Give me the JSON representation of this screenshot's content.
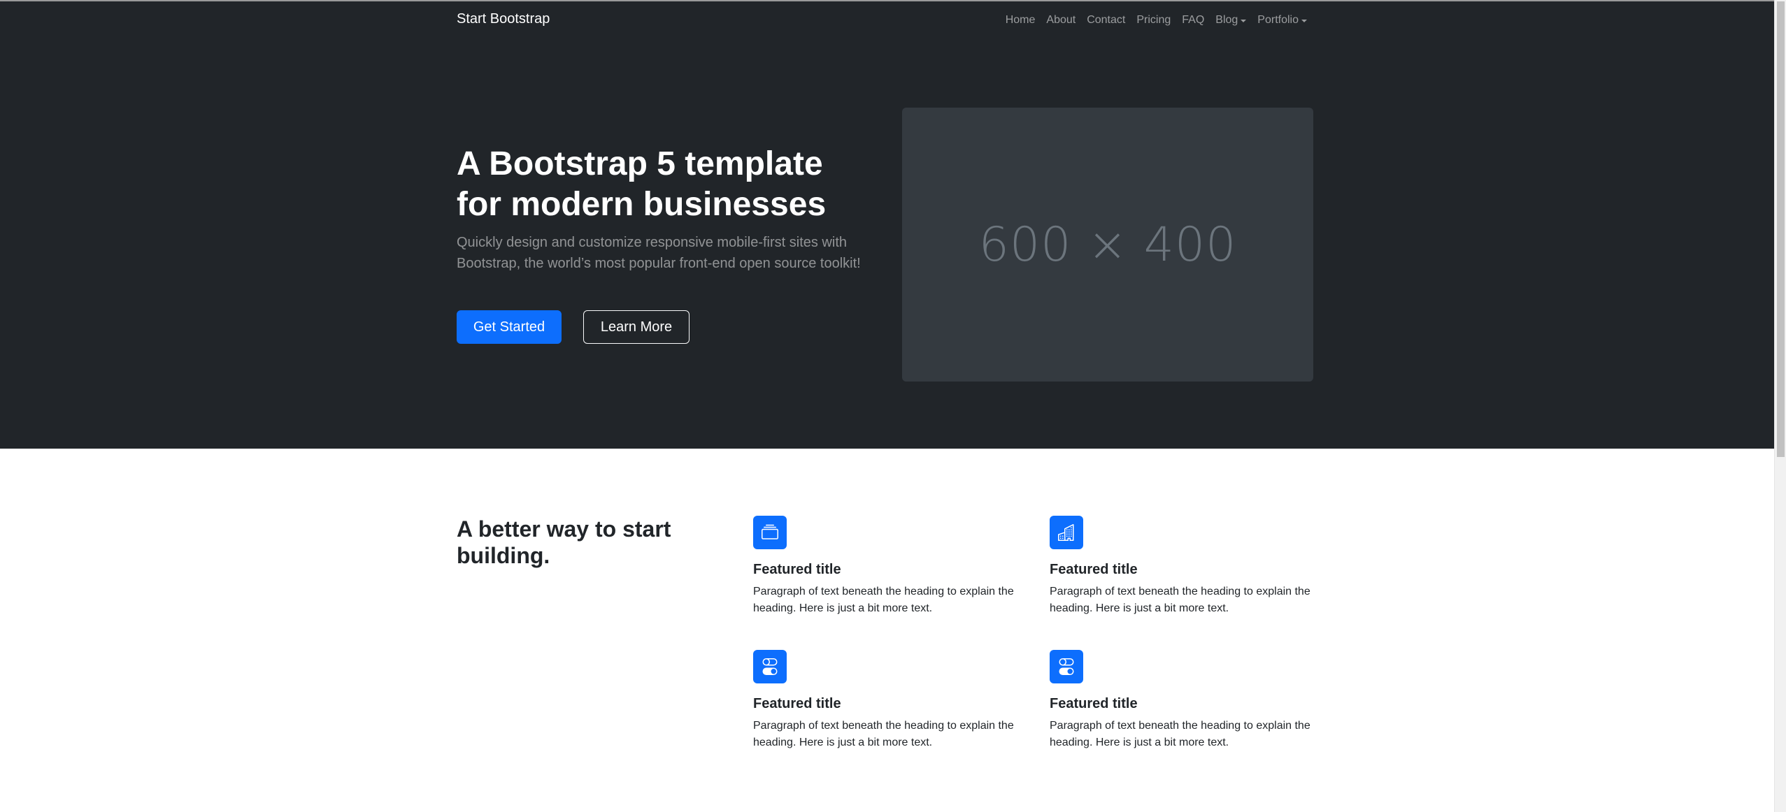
{
  "navbar": {
    "brand": "Start Bootstrap",
    "items": [
      {
        "label": "Home",
        "dropdown": false
      },
      {
        "label": "About",
        "dropdown": false
      },
      {
        "label": "Contact",
        "dropdown": false
      },
      {
        "label": "Pricing",
        "dropdown": false
      },
      {
        "label": "FAQ",
        "dropdown": false
      },
      {
        "label": "Blog",
        "dropdown": true
      },
      {
        "label": "Portfolio",
        "dropdown": true
      }
    ]
  },
  "hero": {
    "title": "A Bootstrap 5 template for modern businesses",
    "lead": "Quickly design and customize responsive mobile-first sites with Bootstrap, the world’s most popular front-end open source toolkit!",
    "primary_button": "Get Started",
    "secondary_button": "Learn More",
    "image_placeholder": "600 × 400"
  },
  "features": {
    "heading": "A better way to start building.",
    "items": [
      {
        "icon": "collection-icon",
        "title": "Featured title",
        "text": "Paragraph of text beneath the heading to explain the heading. Here is just a bit more text."
      },
      {
        "icon": "building-icon",
        "title": "Featured title",
        "text": "Paragraph of text beneath the heading to explain the heading. Here is just a bit more text."
      },
      {
        "icon": "toggles-icon",
        "title": "Featured title",
        "text": "Paragraph of text beneath the heading to explain the heading. Here is just a bit more text."
      },
      {
        "icon": "toggles-icon",
        "title": "Featured title",
        "text": "Paragraph of text beneath the heading to explain the heading. Here is just a bit more text."
      }
    ]
  },
  "colors": {
    "dark_bg": "#212529",
    "primary": "#0d6efd",
    "placeholder_bg": "#343a40"
  }
}
